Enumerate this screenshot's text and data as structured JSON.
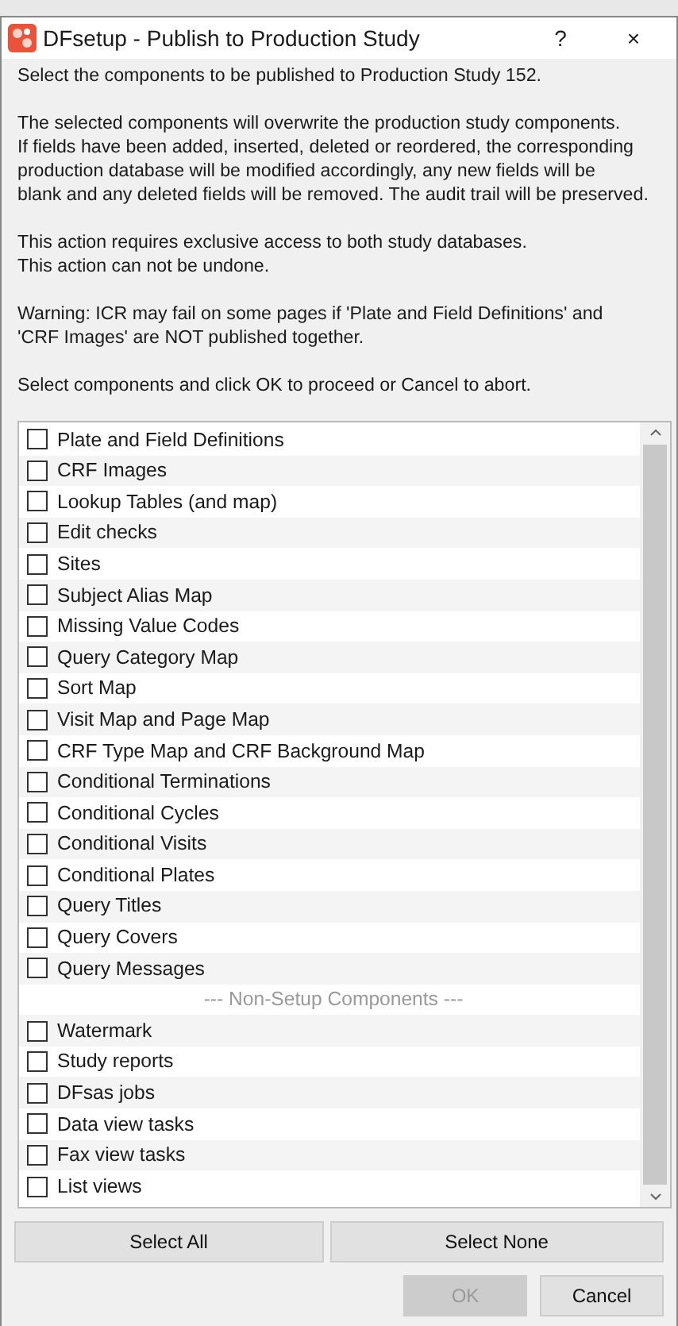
{
  "window": {
    "title": "DFsetup - Publish to Production Study",
    "help": "?",
    "close": "×"
  },
  "paragraphs": [
    [
      "Select the components to be published to Production Study 152."
    ],
    [
      "The selected components will overwrite the production study components.",
      "If fields have been added, inserted, deleted or reordered, the corresponding",
      "production database will be modified accordingly, any new fields will be",
      "blank and any deleted fields will be removed. The audit trail will be preserved."
    ],
    [
      "This action requires exclusive access to both study databases.",
      "This action can not be undone."
    ],
    [
      "Warning: ICR may fail on some pages if 'Plate and Field Definitions' and",
      "'CRF Images' are NOT published together."
    ],
    [
      "Select components and click OK to proceed or Cancel to abort."
    ]
  ],
  "components": [
    {
      "kind": "checkbox",
      "label": "Plate and Field Definitions",
      "checked": false
    },
    {
      "kind": "checkbox",
      "label": "CRF Images",
      "checked": false
    },
    {
      "kind": "checkbox",
      "label": "Lookup Tables (and map)",
      "checked": false
    },
    {
      "kind": "checkbox",
      "label": "Edit checks",
      "checked": false
    },
    {
      "kind": "checkbox",
      "label": "Sites",
      "checked": false
    },
    {
      "kind": "checkbox",
      "label": "Subject Alias Map",
      "checked": false
    },
    {
      "kind": "checkbox",
      "label": "Missing Value Codes",
      "checked": false
    },
    {
      "kind": "checkbox",
      "label": "Query Category Map",
      "checked": false
    },
    {
      "kind": "checkbox",
      "label": "Sort Map",
      "checked": false
    },
    {
      "kind": "checkbox",
      "label": "Visit Map and Page Map",
      "checked": false
    },
    {
      "kind": "checkbox",
      "label": "CRF Type Map and CRF Background Map",
      "checked": false
    },
    {
      "kind": "checkbox",
      "label": "Conditional Terminations",
      "checked": false
    },
    {
      "kind": "checkbox",
      "label": "Conditional Cycles",
      "checked": false
    },
    {
      "kind": "checkbox",
      "label": "Conditional Visits",
      "checked": false
    },
    {
      "kind": "checkbox",
      "label": "Conditional Plates",
      "checked": false
    },
    {
      "kind": "checkbox",
      "label": "Query Titles",
      "checked": false
    },
    {
      "kind": "checkbox",
      "label": "Query Covers",
      "checked": false
    },
    {
      "kind": "checkbox",
      "label": "Query Messages",
      "checked": false
    },
    {
      "kind": "separator",
      "label": "--- Non-Setup Components ---"
    },
    {
      "kind": "checkbox",
      "label": "Watermark",
      "checked": false
    },
    {
      "kind": "checkbox",
      "label": "Study reports",
      "checked": false
    },
    {
      "kind": "checkbox",
      "label": "DFsas jobs",
      "checked": false
    },
    {
      "kind": "checkbox",
      "label": "Data view tasks",
      "checked": false
    },
    {
      "kind": "checkbox",
      "label": "Fax view tasks",
      "checked": false
    },
    {
      "kind": "checkbox",
      "label": "List views",
      "checked": false
    }
  ],
  "select_buttons": [
    {
      "label": "Select All"
    },
    {
      "label": "Select None"
    }
  ],
  "buttons": [
    {
      "label": "OK",
      "disabled": true
    },
    {
      "label": "Cancel",
      "disabled": false
    }
  ]
}
